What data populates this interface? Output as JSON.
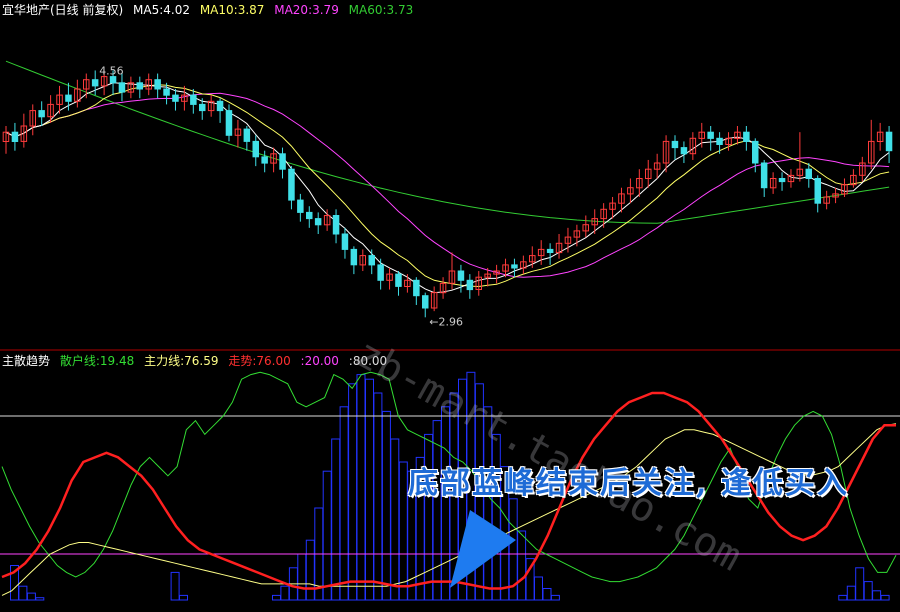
{
  "header": {
    "title": "宜华地产(日线 前复权)",
    "ma5": "MA5:4.02",
    "ma10": "MA10:3.87",
    "ma20": "MA20:3.79",
    "ma60": "MA60:3.73"
  },
  "indicator_header": {
    "name": "主散趋势",
    "retail": "散户线:19.48",
    "main": "主力线:76.59",
    "trend": "走势:76.00",
    "level_low": ":20.00",
    "level_high": ":80.00"
  },
  "annotations": {
    "high_label": "4.56",
    "low_label": "←2.96",
    "banner": "底部蓝峰结束后关注, 逢低买入",
    "watermark": "zb-mart.taobao.com"
  },
  "colors": {
    "up": "#ff3b3b",
    "down": "#40e0e8",
    "ma5": "#ffffff",
    "ma10": "#ffff66",
    "ma20": "#ff44ff",
    "ma60": "#33cc33",
    "retail": "#33dd33",
    "main": "#ffff88",
    "trend": "#ff2020",
    "bars": "#2233ff",
    "banner": "#1e6bd6"
  },
  "chart_data": [
    {
      "type": "candlestick",
      "title": "宜华地产(日线 前复权)",
      "ylim": [
        2.8,
        4.9
      ],
      "annotated_high": 4.56,
      "annotated_low": 2.96,
      "series": [
        {
          "name": "MA5",
          "last": 4.02
        },
        {
          "name": "MA10",
          "last": 3.87
        },
        {
          "name": "MA20",
          "last": 3.79
        },
        {
          "name": "MA60",
          "last": 3.73
        }
      ],
      "candles": [
        [
          4.1,
          4.16,
          4.02,
          4.2
        ],
        [
          4.16,
          4.1,
          4.04,
          4.22
        ],
        [
          4.1,
          4.2,
          4.06,
          4.28
        ],
        [
          4.2,
          4.3,
          4.14,
          4.34
        ],
        [
          4.3,
          4.26,
          4.2,
          4.36
        ],
        [
          4.26,
          4.34,
          4.22,
          4.4
        ],
        [
          4.34,
          4.4,
          4.28,
          4.46
        ],
        [
          4.4,
          4.36,
          4.3,
          4.48
        ],
        [
          4.36,
          4.44,
          4.32,
          4.5
        ],
        [
          4.44,
          4.5,
          4.38,
          4.54
        ],
        [
          4.5,
          4.46,
          4.4,
          4.56
        ],
        [
          4.46,
          4.52,
          4.4,
          4.56
        ],
        [
          4.52,
          4.48,
          4.4,
          4.56
        ],
        [
          4.48,
          4.42,
          4.36,
          4.54
        ],
        [
          4.42,
          4.48,
          4.38,
          4.52
        ],
        [
          4.48,
          4.44,
          4.38,
          4.52
        ],
        [
          4.44,
          4.5,
          4.4,
          4.54
        ],
        [
          4.5,
          4.44,
          4.38,
          4.54
        ],
        [
          4.44,
          4.4,
          4.34,
          4.48
        ],
        [
          4.4,
          4.36,
          4.3,
          4.44
        ],
        [
          4.36,
          4.4,
          4.3,
          4.46
        ],
        [
          4.4,
          4.34,
          4.28,
          4.44
        ],
        [
          4.34,
          4.3,
          4.24,
          4.38
        ],
        [
          4.3,
          4.36,
          4.26,
          4.4
        ],
        [
          4.36,
          4.3,
          4.22,
          4.38
        ],
        [
          4.3,
          4.14,
          4.1,
          4.34
        ],
        [
          4.14,
          4.18,
          4.06,
          4.24
        ],
        [
          4.18,
          4.1,
          4.04,
          4.2
        ],
        [
          4.1,
          4.0,
          3.94,
          4.14
        ],
        [
          4.0,
          3.96,
          3.9,
          4.04
        ],
        [
          3.96,
          4.02,
          3.9,
          4.06
        ],
        [
          4.02,
          3.92,
          3.86,
          4.06
        ],
        [
          3.92,
          3.72,
          3.66,
          3.94
        ],
        [
          3.72,
          3.64,
          3.58,
          3.76
        ],
        [
          3.64,
          3.6,
          3.54,
          3.68
        ],
        [
          3.6,
          3.56,
          3.5,
          3.64
        ],
        [
          3.56,
          3.62,
          3.52,
          3.66
        ],
        [
          3.62,
          3.5,
          3.44,
          3.66
        ],
        [
          3.5,
          3.4,
          3.34,
          3.54
        ],
        [
          3.4,
          3.3,
          3.24,
          3.42
        ],
        [
          3.3,
          3.36,
          3.26,
          3.4
        ],
        [
          3.36,
          3.3,
          3.24,
          3.4
        ],
        [
          3.3,
          3.2,
          3.14,
          3.34
        ],
        [
          3.2,
          3.24,
          3.14,
          3.28
        ],
        [
          3.24,
          3.16,
          3.1,
          3.26
        ],
        [
          3.16,
          3.2,
          3.12,
          3.24
        ],
        [
          3.2,
          3.1,
          3.04,
          3.22
        ],
        [
          3.1,
          3.02,
          2.96,
          3.12
        ],
        [
          3.02,
          3.12,
          3.0,
          3.16
        ],
        [
          3.12,
          3.18,
          3.08,
          3.22
        ],
        [
          3.18,
          3.26,
          3.14,
          3.38
        ],
        [
          3.26,
          3.2,
          3.12,
          3.3
        ],
        [
          3.2,
          3.14,
          3.08,
          3.24
        ],
        [
          3.14,
          3.22,
          3.1,
          3.26
        ],
        [
          3.22,
          3.24,
          3.16,
          3.28
        ],
        [
          3.24,
          3.26,
          3.18,
          3.3
        ],
        [
          3.26,
          3.3,
          3.22,
          3.34
        ],
        [
          3.3,
          3.28,
          3.22,
          3.34
        ],
        [
          3.28,
          3.32,
          3.24,
          3.36
        ],
        [
          3.32,
          3.36,
          3.28,
          3.42
        ],
        [
          3.36,
          3.4,
          3.3,
          3.46
        ],
        [
          3.4,
          3.38,
          3.3,
          3.44
        ],
        [
          3.38,
          3.44,
          3.34,
          3.5
        ],
        [
          3.44,
          3.48,
          3.38,
          3.54
        ],
        [
          3.48,
          3.52,
          3.42,
          3.56
        ],
        [
          3.52,
          3.56,
          3.48,
          3.62
        ],
        [
          3.56,
          3.6,
          3.5,
          3.66
        ],
        [
          3.6,
          3.66,
          3.54,
          3.7
        ],
        [
          3.66,
          3.7,
          3.6,
          3.74
        ],
        [
          3.7,
          3.76,
          3.64,
          3.8
        ],
        [
          3.76,
          3.8,
          3.7,
          3.86
        ],
        [
          3.8,
          3.86,
          3.74,
          3.92
        ],
        [
          3.86,
          3.92,
          3.8,
          3.98
        ],
        [
          3.92,
          3.96,
          3.86,
          4.02
        ],
        [
          3.96,
          4.1,
          3.9,
          4.14
        ],
        [
          4.1,
          4.06,
          3.98,
          4.14
        ],
        [
          4.06,
          4.02,
          3.96,
          4.1
        ],
        [
          4.02,
          4.12,
          3.98,
          4.16
        ],
        [
          4.12,
          4.16,
          4.06,
          4.22
        ],
        [
          4.16,
          4.12,
          4.04,
          4.2
        ],
        [
          4.12,
          4.08,
          4.02,
          4.16
        ],
        [
          4.08,
          4.12,
          4.04,
          4.16
        ],
        [
          4.12,
          4.16,
          4.08,
          4.2
        ],
        [
          4.16,
          4.1,
          4.04,
          4.2
        ],
        [
          4.1,
          3.96,
          3.9,
          4.12
        ],
        [
          3.96,
          3.8,
          3.74,
          3.98
        ],
        [
          3.8,
          3.86,
          3.76,
          3.9
        ],
        [
          3.86,
          3.84,
          3.78,
          3.9
        ],
        [
          3.84,
          3.88,
          3.8,
          3.92
        ],
        [
          3.88,
          3.92,
          3.84,
          4.16
        ],
        [
          3.92,
          3.86,
          3.8,
          3.96
        ],
        [
          3.86,
          3.7,
          3.64,
          3.88
        ],
        [
          3.7,
          3.74,
          3.66,
          3.78
        ],
        [
          3.74,
          3.76,
          3.7,
          3.8
        ],
        [
          3.76,
          3.82,
          3.74,
          3.86
        ],
        [
          3.82,
          3.88,
          3.8,
          3.92
        ],
        [
          3.88,
          3.96,
          3.84,
          4.0
        ],
        [
          3.96,
          4.1,
          3.92,
          4.24
        ],
        [
          4.1,
          4.16,
          4.04,
          4.22
        ],
        [
          4.16,
          4.04,
          3.96,
          4.2
        ]
      ]
    },
    {
      "type": "line",
      "title": "主散趋势",
      "ylim": [
        0,
        100
      ],
      "levels": [
        20,
        80
      ],
      "series": [
        {
          "name": "散户线",
          "last": 19.48,
          "values": [
            58,
            48,
            40,
            32,
            25,
            20,
            15,
            12,
            10,
            12,
            16,
            22,
            30,
            40,
            50,
            58,
            62,
            58,
            54,
            58,
            74,
            78,
            72,
            76,
            80,
            86,
            96,
            98,
            99,
            98,
            96,
            94,
            86,
            84,
            86,
            88,
            98,
            96,
            92,
            98,
            99,
            98,
            96,
            80,
            74,
            72,
            70,
            68,
            66,
            62,
            60,
            56,
            50,
            44,
            40,
            34,
            30,
            26,
            22,
            20,
            18,
            16,
            14,
            12,
            10,
            9,
            8,
            8,
            9,
            10,
            12,
            14,
            18,
            22,
            28,
            36,
            44,
            52,
            60,
            66,
            56,
            44,
            40,
            52,
            62,
            70,
            76,
            80,
            82,
            80,
            72,
            58,
            40,
            28,
            18,
            12,
            12,
            19.48
          ]
        },
        {
          "name": "主力线",
          "last": 76.59,
          "values": [
            2,
            4,
            8,
            12,
            16,
            20,
            22,
            24,
            25,
            25,
            24,
            23,
            22,
            21,
            20,
            19,
            18,
            17,
            16,
            15,
            14,
            13,
            12,
            11,
            10,
            9,
            8,
            7,
            7,
            7,
            7,
            7,
            7,
            6,
            6,
            6,
            6,
            6,
            6,
            6,
            6,
            7,
            8,
            10,
            12,
            14,
            16,
            18,
            20,
            22,
            24,
            26,
            28,
            30,
            32,
            34,
            36,
            38,
            40,
            42,
            44,
            46,
            48,
            50,
            52,
            55,
            58,
            62,
            66,
            70,
            72,
            74,
            74,
            73,
            72,
            70,
            68,
            66,
            64,
            62,
            60,
            58,
            56,
            55,
            54,
            55,
            56,
            58,
            62,
            66,
            70,
            74,
            76,
            76.59
          ]
        },
        {
          "name": "走势",
          "last": 76.0,
          "values": [
            10,
            12,
            16,
            22,
            30,
            40,
            52,
            60,
            62,
            64,
            62,
            58,
            54,
            48,
            40,
            32,
            26,
            22,
            20,
            18,
            16,
            14,
            12,
            10,
            8,
            6,
            5,
            5,
            6,
            7,
            8,
            8,
            8,
            7,
            6,
            6,
            7,
            8,
            8,
            8,
            7,
            6,
            5,
            5,
            6,
            10,
            18,
            28,
            40,
            52,
            62,
            70,
            76,
            82,
            86,
            88,
            90,
            90,
            88,
            86,
            82,
            76,
            70,
            62,
            54,
            46,
            38,
            32,
            28,
            26,
            28,
            32,
            40,
            50,
            60,
            70,
            76,
            76.0
          ]
        }
      ],
      "bars": {
        "name": "主力",
        "values": [
          0,
          15,
          6,
          3,
          1,
          0,
          0,
          0,
          0,
          0,
          0,
          0,
          0,
          0,
          0,
          0,
          0,
          0,
          0,
          0,
          12,
          2,
          0,
          0,
          0,
          0,
          0,
          0,
          0,
          0,
          0,
          0,
          2,
          6,
          14,
          20,
          26,
          40,
          56,
          70,
          84,
          94,
          98,
          96,
          90,
          82,
          70,
          60,
          56,
          62,
          72,
          78,
          84,
          90,
          96,
          99,
          94,
          84,
          72,
          58,
          44,
          30,
          18,
          10,
          5,
          2,
          0,
          0,
          0,
          0,
          0,
          0,
          0,
          0,
          0,
          0,
          0,
          0,
          0,
          0,
          0,
          0,
          0,
          0,
          0,
          0,
          0,
          0,
          0,
          0,
          0,
          0,
          0,
          0,
          0,
          0,
          0,
          0,
          0,
          2,
          6,
          14,
          8,
          4,
          2,
          0
        ]
      }
    }
  ]
}
